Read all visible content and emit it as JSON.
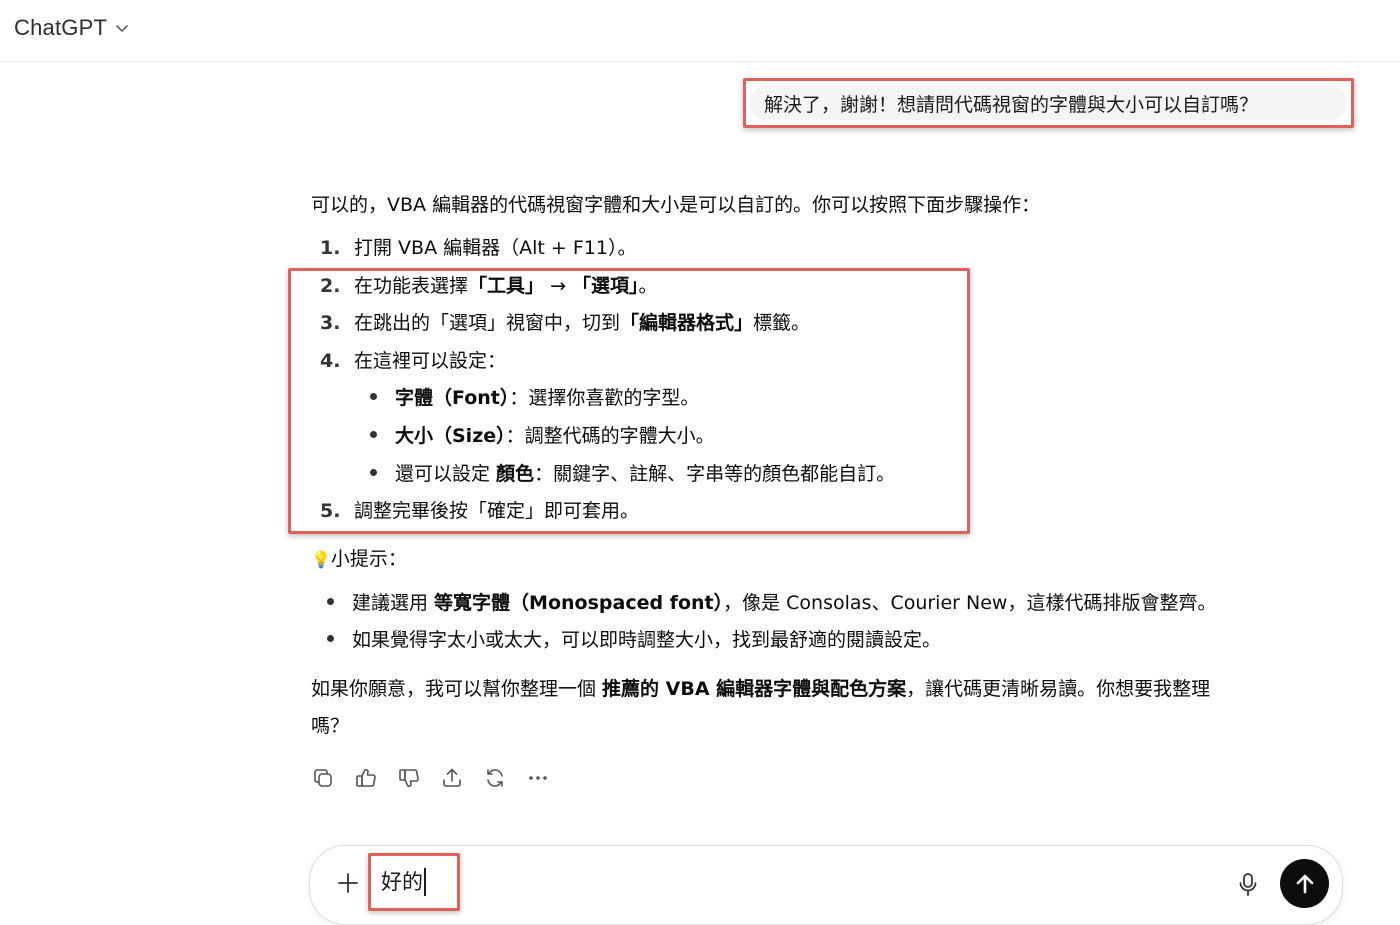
{
  "header": {
    "model_name": "ChatGPT"
  },
  "user_message": "解決了，謝謝！想請問代碼視窗的字體與大小可以自訂嗎？",
  "assistant": {
    "intro": "可以的，VBA 編輯器的代碼視窗字體和大小是可以自訂的。你可以按照下面步驟操作：",
    "steps": [
      {
        "num": "1.",
        "pre": "打開 VBA 編輯器（Alt + F11）。"
      },
      {
        "num": "2.",
        "pre": "在功能表選擇",
        "b1": "「工具」",
        "mid": " → ",
        "b2": "「選項」",
        "post": "。"
      },
      {
        "num": "3.",
        "pre": "在跳出的「選項」視窗中，切到",
        "b1": "「編輯器格式」",
        "post": "標籤。"
      },
      {
        "num": "4.",
        "pre": "在這裡可以設定："
      },
      {
        "num": "5.",
        "pre": "調整完畢後按「確定」即可套用。"
      }
    ],
    "sub_items": [
      {
        "bold": "字體（Font）",
        "text": "：選擇你喜歡的字型。"
      },
      {
        "bold": "大小（Size）",
        "text": "：調整代碼的字體大小。"
      },
      {
        "pre": "還可以設定 ",
        "bold": "顏色",
        "text": "：關鍵字、註解、字串等的顏色都能自訂。"
      }
    ],
    "tip_icon": "💡",
    "tip_title": "小提示：",
    "tips": [
      {
        "pre": "建議選用 ",
        "bold": "等寬字體（Monospaced font）",
        "text": "，像是 Consolas、Courier New，這樣代碼排版會整齊。"
      },
      {
        "text": "如果覺得字太小或太大，可以即時調整大小，找到最舒適的閱讀設定。"
      }
    ],
    "closing_pre": "如果你願意，我可以幫你整理一個 ",
    "closing_bold": "推薦的 VBA 編輯器字體與配色方案",
    "closing_post": "，讓代碼更清晰易讀。你想要我整理",
    "closing_line2": "嗎？"
  },
  "action_icons": [
    "copy-icon",
    "thumbs-up-icon",
    "thumbs-down-icon",
    "share-icon",
    "regenerate-icon",
    "more-icon"
  ],
  "composer": {
    "value": "好的"
  },
  "colors": {
    "highlight": "#e0605a",
    "send_bg": "#0d0d0d"
  }
}
